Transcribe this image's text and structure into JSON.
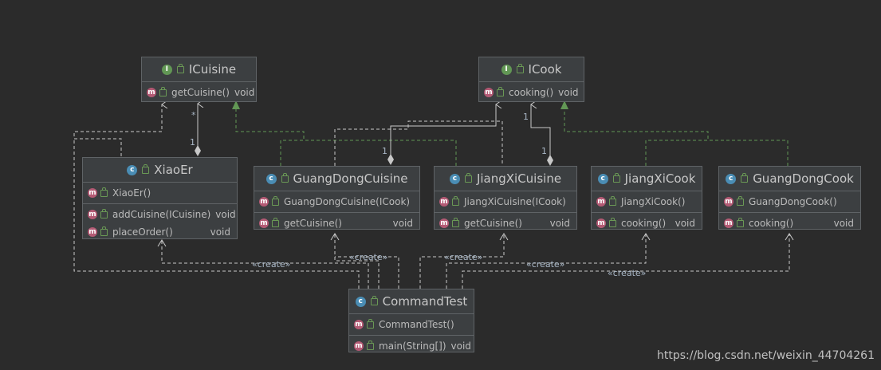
{
  "classes": {
    "icuisine": {
      "kind": "I",
      "name": "ICuisine",
      "methods": [
        {
          "name": "getCuisine()",
          "ret": "void",
          "badge": "m"
        }
      ]
    },
    "icook": {
      "kind": "I",
      "name": "ICook",
      "methods": [
        {
          "name": "cooking()",
          "ret": "void",
          "badge": "m"
        }
      ]
    },
    "xiaoer": {
      "kind": "C",
      "name": "XiaoEr",
      "ctor": "XiaoEr()",
      "methods": [
        {
          "name": "addCuisine(ICuisine)",
          "ret": "void"
        },
        {
          "name": "placeOrder()",
          "ret": "void"
        }
      ]
    },
    "guangdongcuisine": {
      "kind": "C",
      "name": "GuangDongCuisine",
      "ctor": "GuangDongCuisine(ICook)",
      "methods": [
        {
          "name": "getCuisine()",
          "ret": "void"
        }
      ]
    },
    "jiangxicuisine": {
      "kind": "C",
      "name": "JiangXiCuisine",
      "ctor": "JiangXiCuisine(ICook)",
      "methods": [
        {
          "name": "getCuisine()",
          "ret": "void"
        }
      ]
    },
    "jiangxicook": {
      "kind": "C",
      "name": "JiangXiCook",
      "ctor": "JiangXiCook()",
      "methods": [
        {
          "name": "cooking()",
          "ret": "void"
        }
      ]
    },
    "guangdongcook": {
      "kind": "C",
      "name": "GuangDongCook",
      "ctor": "GuangDongCook()",
      "methods": [
        {
          "name": "cooking()",
          "ret": "void"
        }
      ]
    },
    "commandtest": {
      "kind": "C",
      "name": "CommandTest",
      "ctor": "CommandTest()",
      "methods": [
        {
          "name": "main(String[])",
          "ret": "void"
        }
      ]
    }
  },
  "labels": {
    "star": "*",
    "one": "1",
    "create": "«create»"
  },
  "watermark": "https://blog.csdn.net/weixin_44704261",
  "colors": {
    "background": "#2b2b2b",
    "box": "#3c3f41",
    "border": "#5f6366",
    "edge": "#c8c8c8",
    "realization": "#629755",
    "interface_badge": "#629755",
    "class_badge": "#4a8db4",
    "method_badge": "#b35a74"
  }
}
